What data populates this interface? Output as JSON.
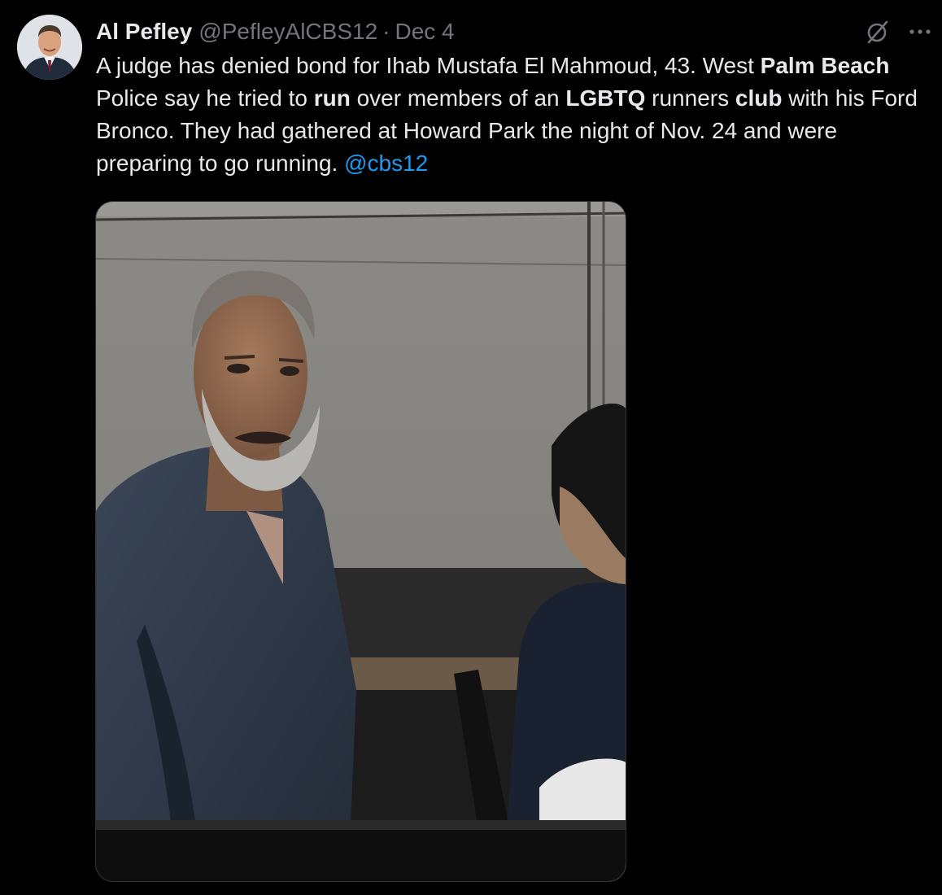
{
  "tweet": {
    "author": {
      "display_name": "Al Pefley",
      "handle": "@PefleyAlCBS12",
      "separator": "·",
      "date": "Dec 4"
    },
    "text_segments": [
      {
        "text": "A judge has denied bond for Ihab Mustafa El Mahmoud, 43. West ",
        "bold": false
      },
      {
        "text": "Palm Beach",
        "bold": true
      },
      {
        "text": " Police say he tried to ",
        "bold": false
      },
      {
        "text": "run",
        "bold": true
      },
      {
        "text": " over members of an ",
        "bold": false
      },
      {
        "text": "LGBTQ",
        "bold": true
      },
      {
        "text": " runners ",
        "bold": false
      },
      {
        "text": "club",
        "bold": true
      },
      {
        "text": " with his Ford Bronco. They had gathered at Howard Park the night of Nov. 24 and were preparing to go running. ",
        "bold": false
      }
    ],
    "mention": "@cbs12",
    "more_label": "···",
    "icons": {
      "grok": "grok-icon",
      "more": "more-icon"
    }
  },
  "colors": {
    "background": "#000000",
    "text_primary": "#e7e9ea",
    "text_secondary": "#71767b",
    "link": "#1d9bf0",
    "border": "#2f3336"
  }
}
